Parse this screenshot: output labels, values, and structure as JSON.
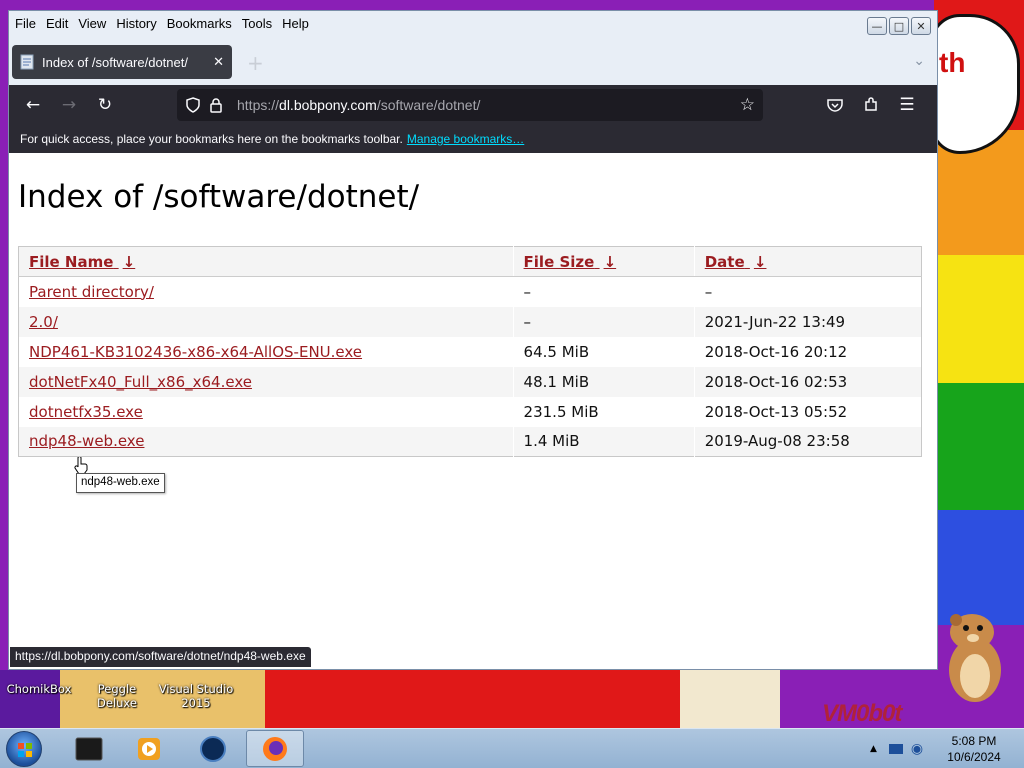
{
  "browser": {
    "menu": [
      "File",
      "Edit",
      "View",
      "History",
      "Bookmarks",
      "Tools",
      "Help"
    ],
    "tab_title": "Index of /software/dotnet/",
    "url_prefix": "https://",
    "url_domain": "dl.bobpony.com",
    "url_path": "/software/dotnet/",
    "bookmark_hint": "For quick access, place your bookmarks here on the bookmarks toolbar.",
    "bookmark_link": "Manage bookmarks…",
    "status_url": "https://dl.bobpony.com/software/dotnet/ndp48-web.exe",
    "tooltip": "ndp48-web.exe"
  },
  "page": {
    "title": "Index of /software/dotnet/",
    "columns": [
      {
        "label": "File Name",
        "sort": "↓"
      },
      {
        "label": "File Size",
        "sort": "↓"
      },
      {
        "label": "Date",
        "sort": "↓"
      }
    ],
    "rows": [
      {
        "name": "Parent directory/",
        "size": "–",
        "date": "–"
      },
      {
        "name": "2.0/",
        "size": "–",
        "date": "2021-Jun-22 13:49"
      },
      {
        "name": "NDP461-KB3102436-x86-x64-AllOS-ENU.exe",
        "size": "64.5 MiB",
        "date": "2018-Oct-16 20:12"
      },
      {
        "name": "dotNetFx40_Full_x86_x64.exe",
        "size": "48.1 MiB",
        "date": "2018-Oct-16 02:53"
      },
      {
        "name": "dotnetfx35.exe",
        "size": "231.5 MiB",
        "date": "2018-Oct-13 05:52"
      },
      {
        "name": "ndp48-web.exe",
        "size": "1.4 MiB",
        "date": "2019-Aug-08 23:58"
      }
    ]
  },
  "desktop": {
    "icons": [
      "ChomikBox",
      "Peggle Deluxe",
      "Visual Studio 2015"
    ],
    "watermark": "VM0b0t",
    "bubble_text": "th"
  },
  "taskbar": {
    "time": "5:08 PM",
    "date": "10/6/2024"
  },
  "colors": {
    "link": "#9b1c20",
    "toolbar": "#2b2a33",
    "bookmark_link": "#00ddff"
  }
}
